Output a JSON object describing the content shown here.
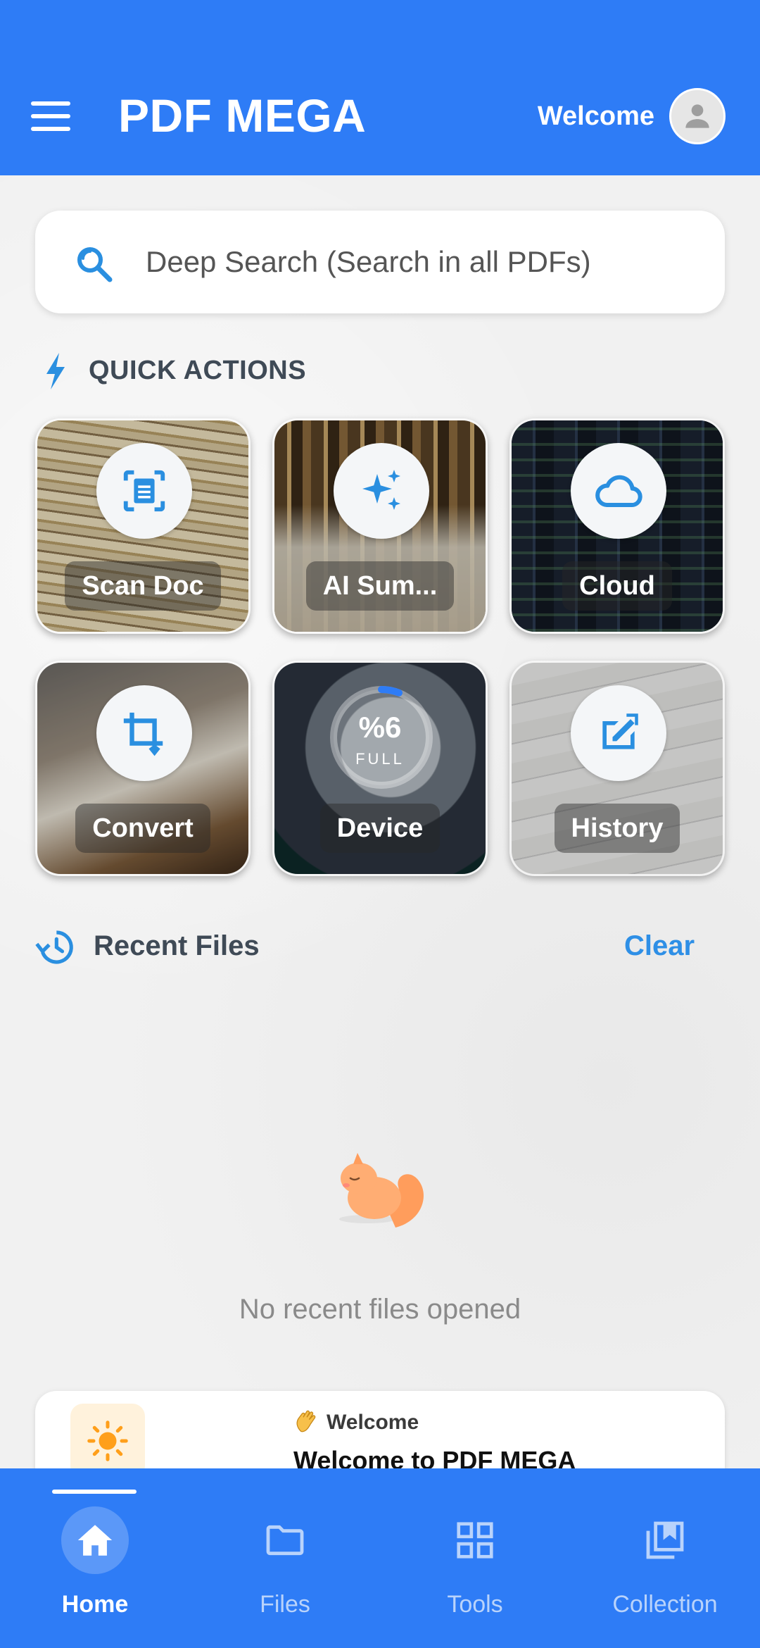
{
  "app_bar": {
    "title": "PDF MEGA",
    "welcome": "Welcome",
    "menu_icon": "hamburger-menu-icon",
    "avatar_icon": "person-icon"
  },
  "search": {
    "placeholder": "Deep Search (Search in all PDFs)",
    "icon": "search-icon"
  },
  "quick_actions": {
    "title": "QUICK ACTIONS",
    "icon": "bolt-icon",
    "tiles": [
      {
        "label": "Scan Doc",
        "icon": "scan-document-icon"
      },
      {
        "label": "AI Sum...",
        "icon": "sparkles-icon"
      },
      {
        "label": "Cloud",
        "icon": "cloud-icon"
      },
      {
        "label": "Convert",
        "icon": "crop-icon"
      },
      {
        "label": "Device",
        "icon": "storage-ring-icon",
        "usage_text": "%6",
        "usage_fraction": 0.06,
        "status": "FULL"
      },
      {
        "label": "History",
        "icon": "history-edit-icon"
      }
    ]
  },
  "recent_files": {
    "title": "Recent Files",
    "clear": "Clear",
    "empty_message": "No recent files opened",
    "icon": "history-icon"
  },
  "welcome_card": {
    "eyebrow": "Welcome",
    "title": "Welcome to PDF MEGA",
    "icon": "sun-icon"
  },
  "bottom_nav": {
    "items": [
      {
        "label": "Home",
        "icon": "home-icon",
        "active": true
      },
      {
        "label": "Files",
        "icon": "folder-icon",
        "active": false
      },
      {
        "label": "Tools",
        "icon": "grid-icon",
        "active": false
      },
      {
        "label": "Collection",
        "icon": "bookmark-collection-icon",
        "active": false
      }
    ]
  },
  "colors": {
    "primary": "#2e7cf6",
    "accent": "#2e8fe6",
    "icon_blue": "#2a8fe0"
  }
}
